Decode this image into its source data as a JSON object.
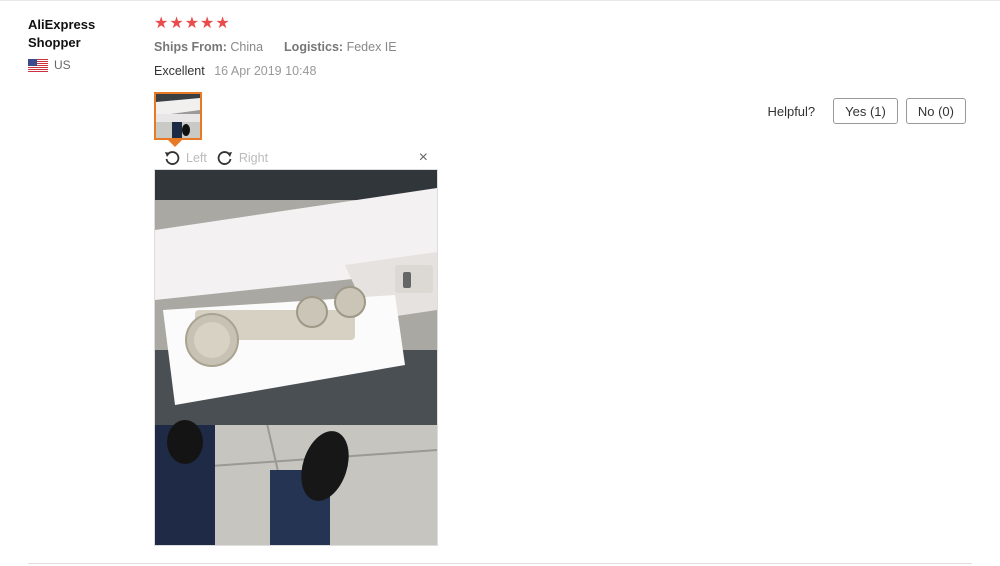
{
  "reviewer": {
    "name": "AliExpress Shopper",
    "country": "US",
    "flag_icon": "us-flag-icon"
  },
  "review": {
    "rating": 5,
    "rating_max": 5,
    "star_color": "#e84c4c",
    "ships_from_label": "Ships From:",
    "ships_from_value": "China",
    "logistics_label": "Logistics:",
    "logistics_value": "Fedex IE",
    "feedback_text": "Excellent",
    "date": "16 Apr 2019 10:48"
  },
  "viewer": {
    "rotate_left_label": "Left",
    "rotate_right_label": "Right",
    "close_label": "×",
    "thumbnail_border_color": "#e87a26"
  },
  "helpful": {
    "label": "Helpful?",
    "yes_label": "Yes (1)",
    "no_label": "No (0)"
  }
}
